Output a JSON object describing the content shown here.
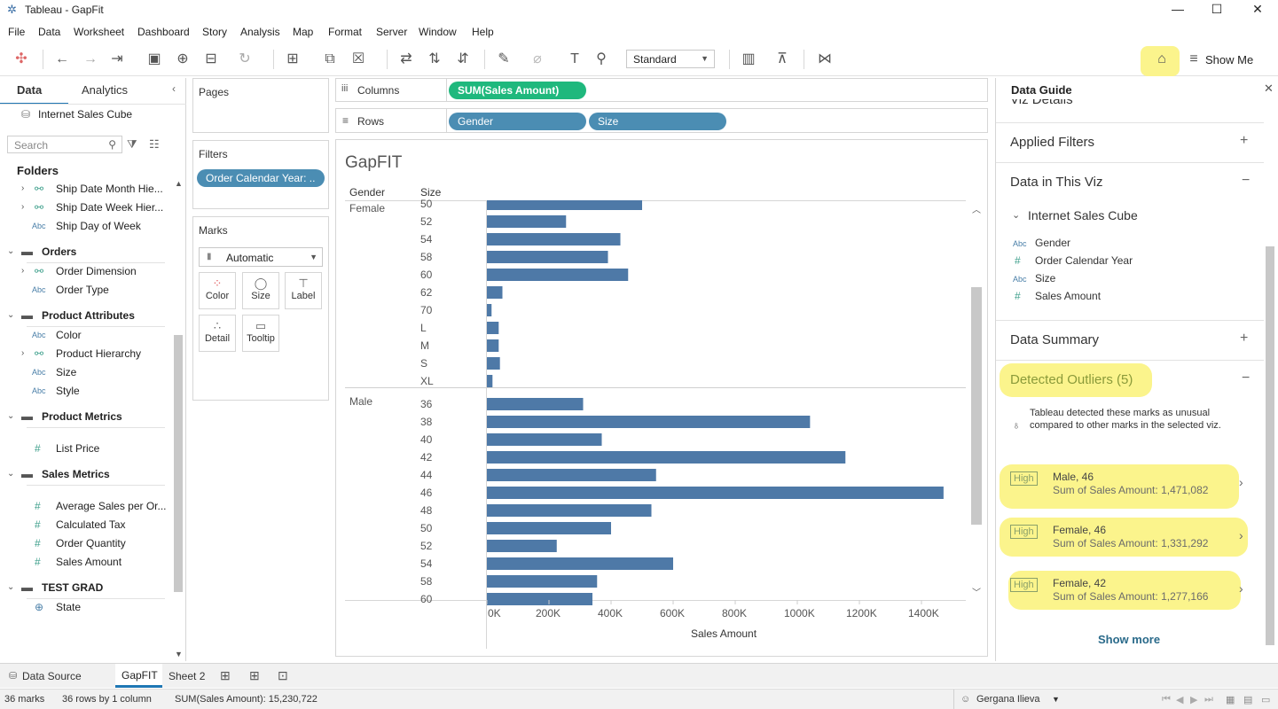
{
  "window": {
    "title": "Tableau - GapFit"
  },
  "menu": [
    "File",
    "Data",
    "Worksheet",
    "Dashboard",
    "Story",
    "Analysis",
    "Map",
    "Format",
    "Server",
    "Window",
    "Help"
  ],
  "toolbar": {
    "fit_select": "Standard",
    "show_me": "Show Me"
  },
  "left_pane": {
    "tabs": [
      "Data",
      "Analytics"
    ],
    "datasource": "Internet Sales Cube",
    "search_placeholder": "Search",
    "folders_label": "Folders",
    "rows": [
      {
        "kind": "field",
        "icon": "hier",
        "label": "Ship Date Month Hie...",
        "chev": true
      },
      {
        "kind": "field",
        "icon": "hier",
        "label": "Ship Date Week Hier...",
        "chev": true
      },
      {
        "kind": "field",
        "icon": "abc",
        "label": "Ship Day of Week"
      },
      {
        "kind": "folder",
        "label": "Orders"
      },
      {
        "kind": "field",
        "icon": "hier",
        "label": "Order Dimension",
        "chev": true
      },
      {
        "kind": "field",
        "icon": "abc",
        "label": "Order Type"
      },
      {
        "kind": "folder",
        "label": "Product Attributes"
      },
      {
        "kind": "field",
        "icon": "abc",
        "label": "Color"
      },
      {
        "kind": "field",
        "icon": "hier",
        "label": "Product Hierarchy",
        "chev": true
      },
      {
        "kind": "field",
        "icon": "abc",
        "label": "Size"
      },
      {
        "kind": "field",
        "icon": "abc",
        "label": "Style"
      },
      {
        "kind": "folder",
        "label": "Product Metrics"
      },
      {
        "kind": "field",
        "icon": "hash",
        "label": "List Price"
      },
      {
        "kind": "folder",
        "label": "Sales Metrics"
      },
      {
        "kind": "field",
        "icon": "hash",
        "label": "Average Sales per Or..."
      },
      {
        "kind": "field",
        "icon": "hash",
        "label": "Calculated Tax"
      },
      {
        "kind": "field",
        "icon": "hash",
        "label": "Order Quantity"
      },
      {
        "kind": "field",
        "icon": "hash",
        "label": "Sales Amount"
      },
      {
        "kind": "folder",
        "label": "TEST GRAD"
      },
      {
        "kind": "field",
        "icon": "globe",
        "label": "State"
      }
    ]
  },
  "shelves": {
    "pages_label": "Pages",
    "filters_label": "Filters",
    "filter_pill": "Order  Calendar Year: ..",
    "marks_label": "Marks",
    "marks_type": "Automatic",
    "mark_buttons": [
      "Color",
      "Size",
      "Label",
      "Detail",
      "Tooltip"
    ],
    "columns_label": "Columns",
    "rows_label": "Rows",
    "columns_pill": "SUM(Sales Amount)",
    "rows_pills": [
      "Gender",
      "Size"
    ]
  },
  "chart_data": {
    "type": "bar",
    "title": "GapFIT",
    "row_headers": [
      "Gender",
      "Size"
    ],
    "xlabel": "Sales Amount",
    "xlim": [
      0,
      1500000
    ],
    "x_ticks": [
      "0K",
      "200K",
      "400K",
      "600K",
      "800K",
      "1000K",
      "1200K",
      "1400K"
    ],
    "groups": [
      {
        "name": "Female",
        "categories": [
          "50",
          "52",
          "54",
          "58",
          "60",
          "62",
          "70",
          "L",
          "M",
          "S",
          "XL"
        ],
        "values": [
          500000,
          255000,
          430000,
          390000,
          455000,
          50000,
          15000,
          38000,
          38000,
          42000,
          18000
        ]
      },
      {
        "name": "Male",
        "categories": [
          "36",
          "38",
          "40",
          "42",
          "44",
          "46",
          "48",
          "50",
          "52",
          "54",
          "58",
          "60"
        ],
        "values": [
          310000,
          1041000,
          370000,
          1155000,
          545000,
          1471082,
          530000,
          400000,
          225000,
          600000,
          355000,
          340000
        ]
      }
    ]
  },
  "data_guide": {
    "title": "Data Guide",
    "viz_details": "Viz Details",
    "applied_filters": "Applied Filters",
    "data_in_viz": "Data in This Viz",
    "cube_name": "Internet Sales Cube",
    "fields": [
      {
        "icon": "Abc",
        "label": "Gender"
      },
      {
        "icon": "#",
        "label": "Order Calendar Year"
      },
      {
        "icon": "Abc",
        "label": "Size"
      },
      {
        "icon": "#",
        "label": "Sales Amount"
      }
    ],
    "data_summary": "Data Summary",
    "outliers_title": "Detected Outliers (5)",
    "outliers_note": "Tableau detected these marks as unusual compared to other marks in the selected viz.",
    "outliers": [
      {
        "badge": "High",
        "title": "Male, 46",
        "sub": "Sum of Sales Amount: 1,471,082"
      },
      {
        "badge": "High",
        "title": "Female, 46",
        "sub": "Sum of Sales Amount: 1,331,292"
      },
      {
        "badge": "High",
        "title": "Female, 42",
        "sub": "Sum of Sales Amount: 1,277,166"
      }
    ],
    "show_more": "Show more"
  },
  "sheet_tabs": {
    "data_source": "Data Source",
    "sheets": [
      "GapFIT",
      "Sheet 2"
    ]
  },
  "status": {
    "marks": "36 marks",
    "rows_cols": "36 rows by 1 column",
    "sum": "SUM(Sales Amount): 15,230,722",
    "user": "Gergana Ilieva"
  },
  "colors": {
    "bar": "#4e79a7",
    "pill_blue": "#4b8db3",
    "pill_green": "#1fb87d",
    "highlight": "#fbf48c"
  }
}
